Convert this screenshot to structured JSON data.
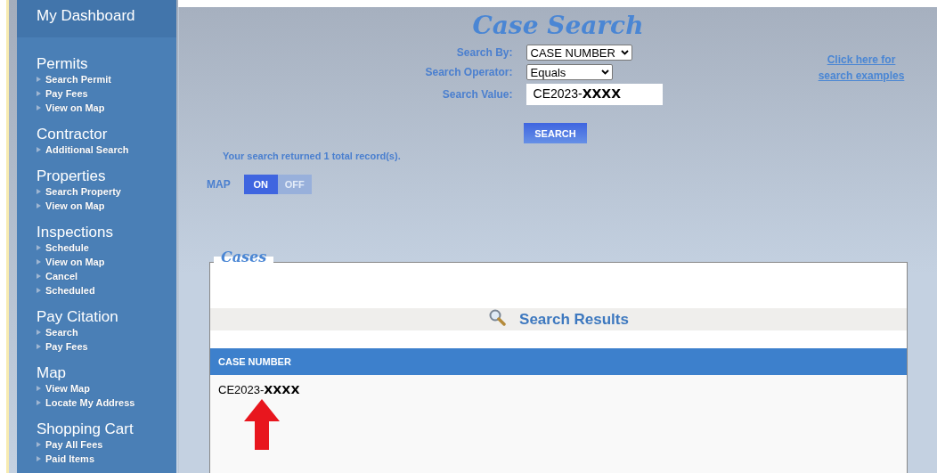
{
  "sidebar": {
    "title": "My Dashboard",
    "sections": [
      {
        "heading": "Permits",
        "items": [
          "Search Permit",
          "Pay Fees",
          "View on Map"
        ]
      },
      {
        "heading": "Contractor",
        "items": [
          "Additional Search"
        ]
      },
      {
        "heading": "Properties",
        "items": [
          "Search Property",
          "View on Map"
        ]
      },
      {
        "heading": "Inspections",
        "items": [
          "Schedule",
          "View on Map",
          "Cancel",
          "Scheduled"
        ]
      },
      {
        "heading": "Pay Citation",
        "items": [
          "Search",
          "Pay Fees"
        ]
      },
      {
        "heading": "Map",
        "items": [
          "View Map",
          "Locate My Address"
        ]
      },
      {
        "heading": "Shopping Cart",
        "items": [
          "Pay All Fees",
          "Paid Items"
        ]
      }
    ]
  },
  "search": {
    "title": "Case Search",
    "fields": [
      {
        "label": "Search By:",
        "kind": "select",
        "value": "CASE NUMBER"
      },
      {
        "label": "Search Operator:",
        "kind": "select",
        "value": "Equals"
      },
      {
        "label": "Search Value:",
        "kind": "text",
        "value": "CE2023-**XXXX**"
      }
    ],
    "help_link": "Click here for search examples",
    "button": "SEARCH",
    "result_message": "Your search returned 1 total record(s).",
    "map_toggle": {
      "label": "MAP",
      "options": [
        {
          "label": "ON",
          "selected": true
        },
        {
          "label": "OFF",
          "selected": false
        }
      ]
    }
  },
  "cases": {
    "legend": "Cases",
    "results_title": "Search Results",
    "columns": [
      "CASE NUMBER"
    ],
    "rows": [
      [
        "CE2023-**XXXX**"
      ]
    ]
  }
}
